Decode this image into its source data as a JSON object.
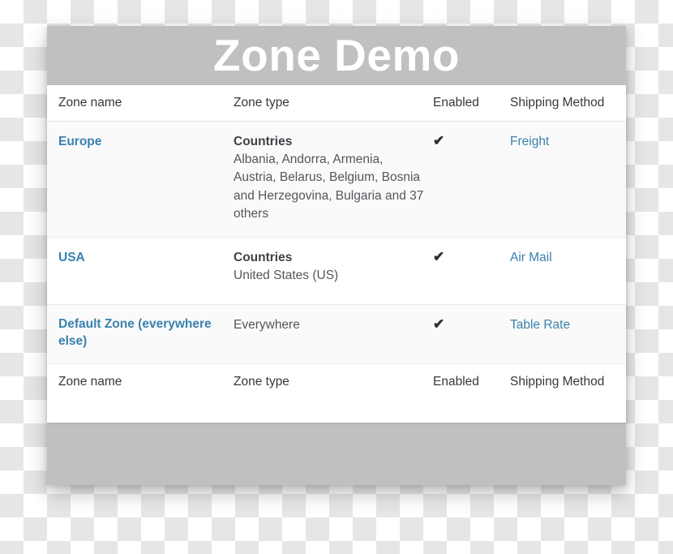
{
  "page": {
    "title": "Zone Demo",
    "accent_blue": "#3a81ae",
    "band_gray": "#c0c0c0",
    "shaded_row": "#fafafa"
  },
  "table": {
    "columns": [
      {
        "key": "zone_name",
        "label": "Zone name"
      },
      {
        "key": "zone_type",
        "label": "Zone type"
      },
      {
        "key": "enabled",
        "label": "Enabled"
      },
      {
        "key": "shipping_method",
        "label": "Shipping Method"
      }
    ],
    "footer": [
      {
        "key": "zone_name",
        "label": "Zone name"
      },
      {
        "key": "zone_type",
        "label": "Zone type"
      },
      {
        "key": "enabled",
        "label": "Enabled"
      },
      {
        "key": "shipping_method",
        "label": "Shipping Method"
      }
    ],
    "rows": [
      {
        "zone_name": "Europe",
        "type_title": "Countries",
        "type_list": "Albania, Andorra, Armenia, Austria, Belarus, Belgium, Bosnia and Herzegovina, Bulgaria and 37 others",
        "enabled_icon": "check-icon",
        "enabled_glyph": "✔",
        "shipping_method": "Freight"
      },
      {
        "zone_name": "USA",
        "type_title": "Countries",
        "type_list": "United States (US)",
        "enabled_icon": "check-icon",
        "enabled_glyph": "✔",
        "shipping_method": "Air Mail"
      },
      {
        "zone_name": "Default Zone (everywhere else)",
        "type_title": "",
        "type_list": "Everywhere",
        "enabled_icon": "check-icon",
        "enabled_glyph": "✔",
        "shipping_method": "Table Rate"
      }
    ]
  }
}
